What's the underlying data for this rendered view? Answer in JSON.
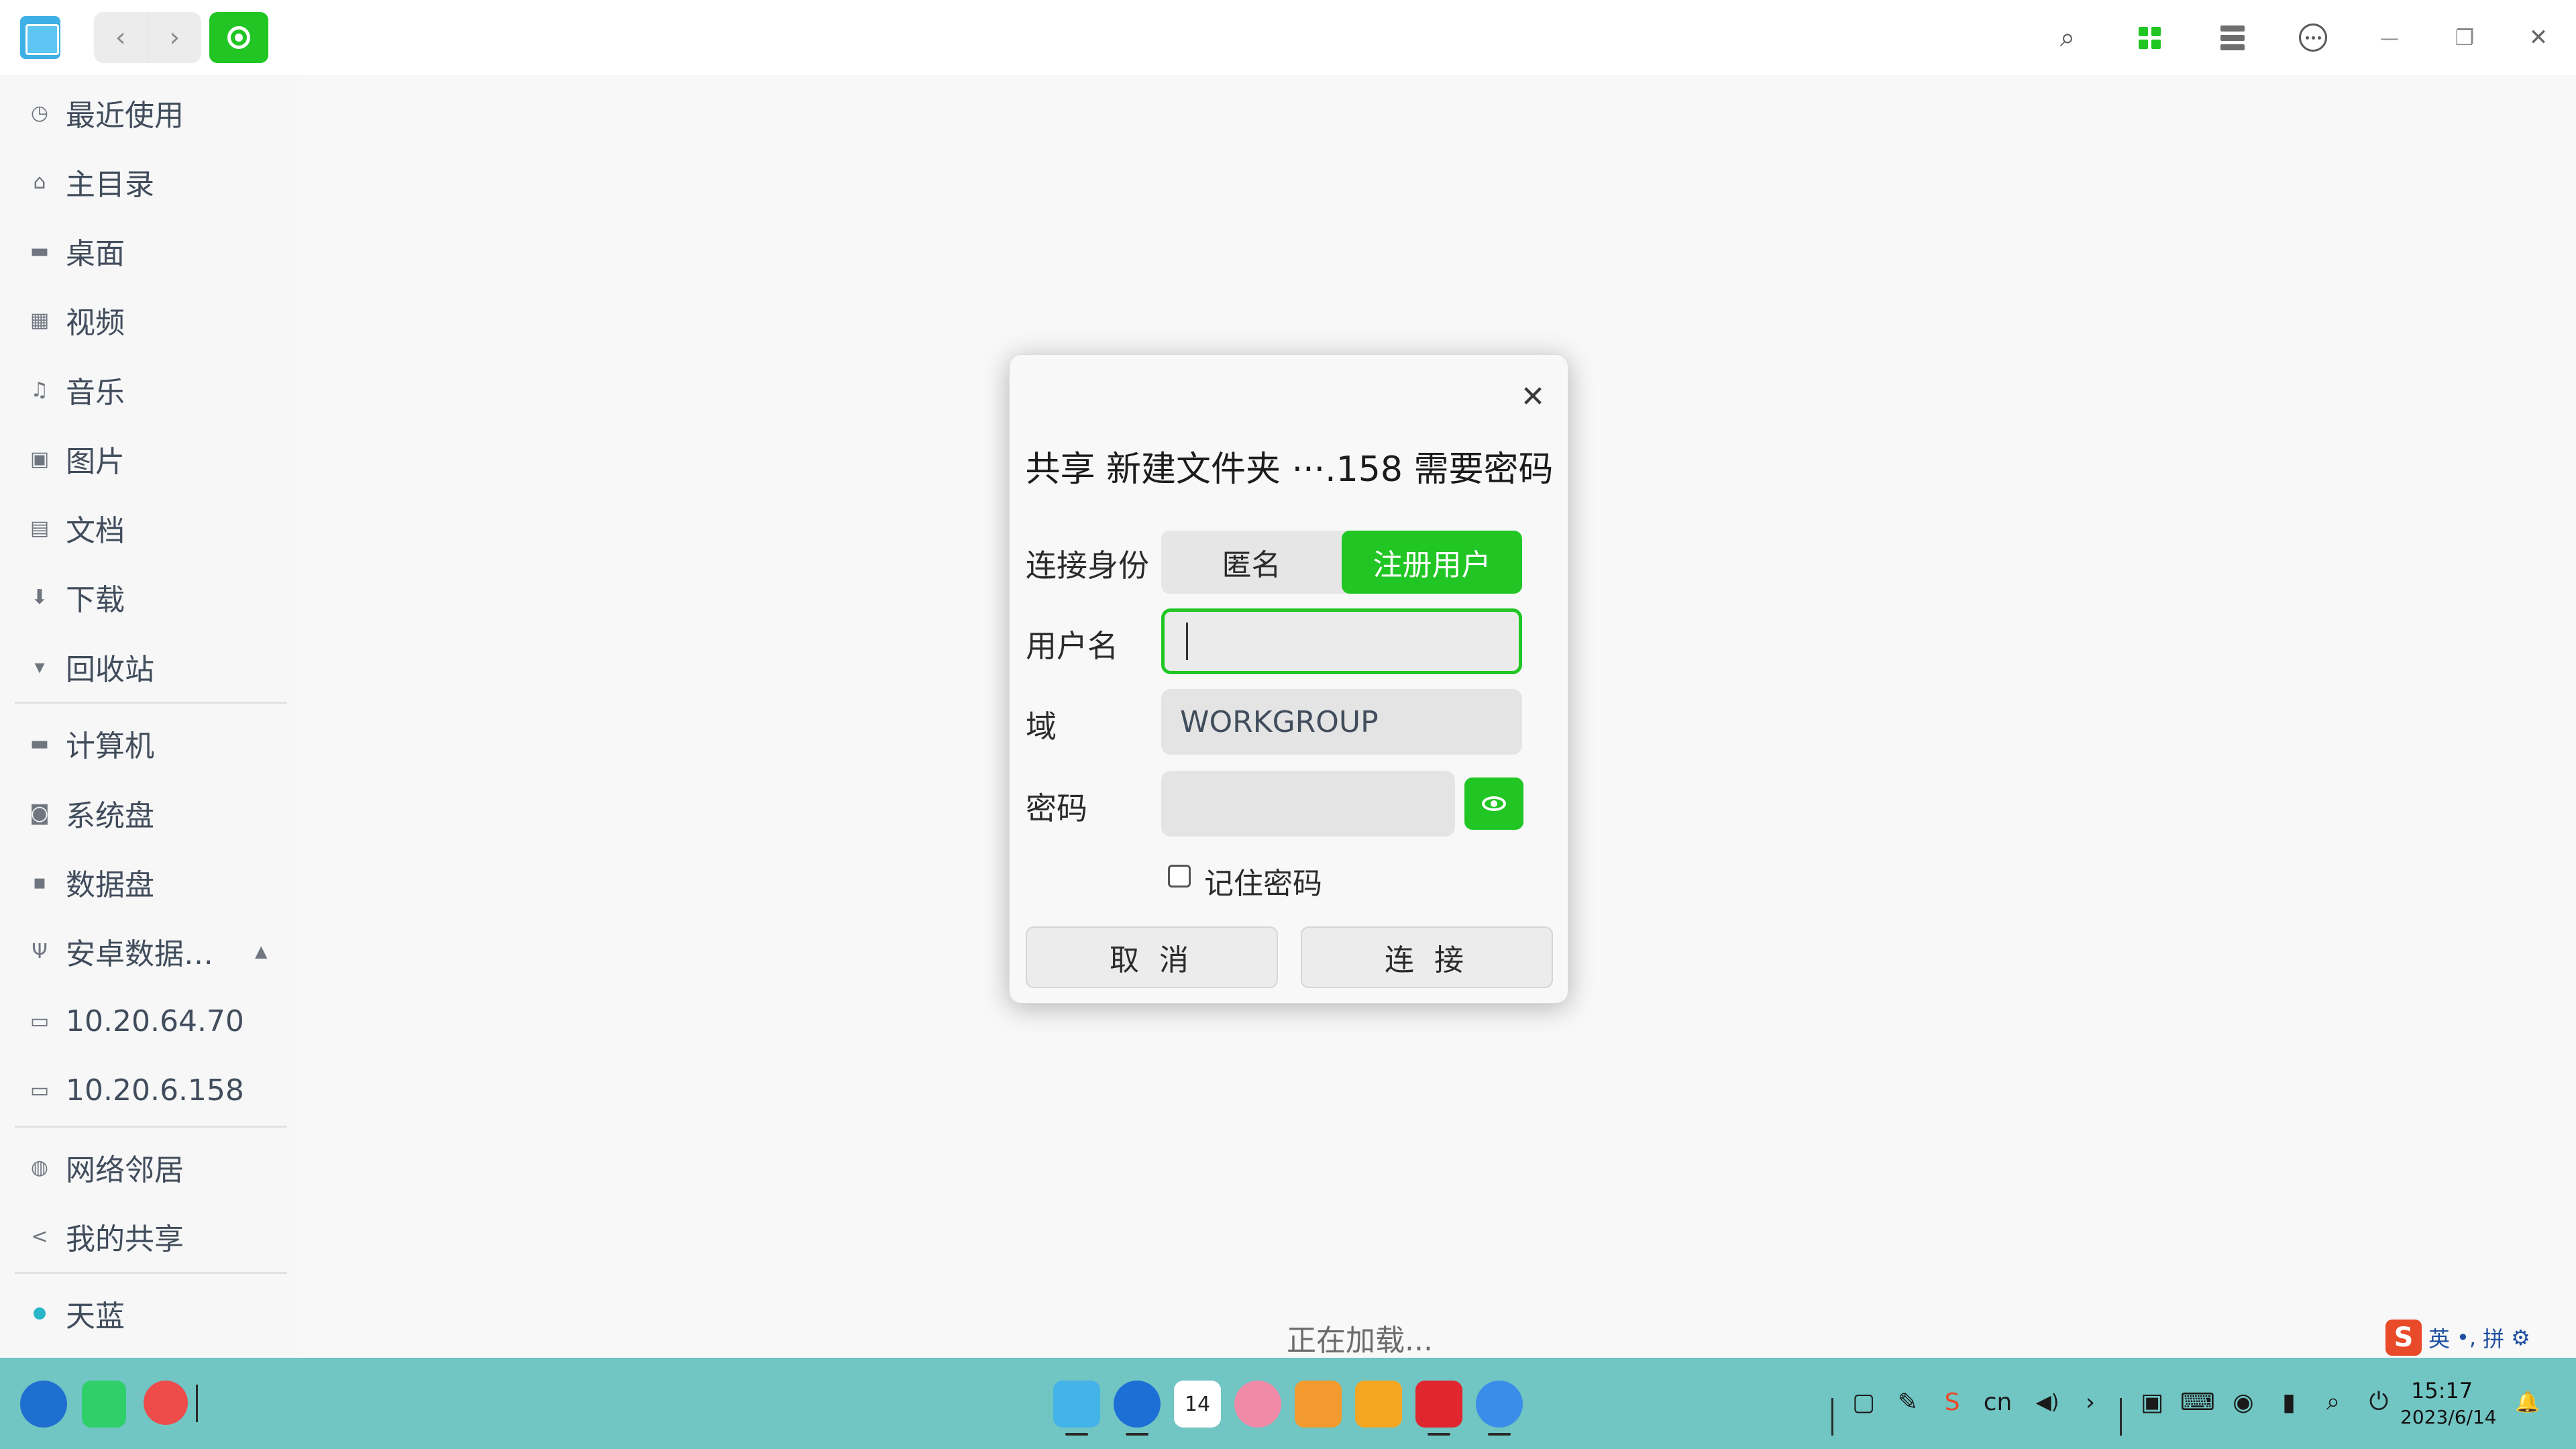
{
  "titlebar": {
    "back_icon": "‹",
    "forward_icon": "›",
    "icons": [
      "search-icon",
      "grid-view-icon",
      "list-view-icon",
      "more-icon",
      "minimize-icon",
      "maximize-icon",
      "close-icon"
    ],
    "search_glyph": "⌕",
    "minimize_glyph": "—",
    "maximize_glyph": "❐",
    "close_glyph": "✕"
  },
  "sidebar": {
    "items": [
      {
        "label": "最近使用",
        "icon": "clock-icon",
        "glyph": "◷"
      },
      {
        "label": "主目录",
        "icon": "home-icon",
        "glyph": "⌂"
      },
      {
        "label": "桌面",
        "icon": "desktop-icon",
        "glyph": "▬"
      },
      {
        "label": "视频",
        "icon": "video-icon",
        "glyph": "▦"
      },
      {
        "label": "音乐",
        "icon": "music-icon",
        "glyph": "♫"
      },
      {
        "label": "图片",
        "icon": "picture-icon",
        "glyph": "▣"
      },
      {
        "label": "文档",
        "icon": "document-icon",
        "glyph": "▤"
      },
      {
        "label": "下载",
        "icon": "download-icon",
        "glyph": "⬇"
      },
      {
        "label": "回收站",
        "icon": "trash-icon",
        "glyph": "▾"
      },
      {
        "label": "计算机",
        "icon": "computer-icon",
        "glyph": "▬"
      },
      {
        "label": "系统盘",
        "icon": "system-disk-icon",
        "glyph": "◙"
      },
      {
        "label": "数据盘",
        "icon": "data-disk-icon",
        "glyph": "▪"
      },
      {
        "label": "安卓数据…",
        "icon": "usb-icon",
        "glyph": "Ψ",
        "eject": "▲"
      },
      {
        "label": "10.20.64.70",
        "icon": "network-share-icon",
        "glyph": "▭"
      },
      {
        "label": "10.20.6.158",
        "icon": "network-share-icon",
        "glyph": "▭"
      },
      {
        "label": "网络邻居",
        "icon": "network-icon",
        "glyph": "◍"
      },
      {
        "label": "我的共享",
        "icon": "share-icon",
        "glyph": "<"
      },
      {
        "label": "天蓝",
        "icon": "tag-dot-icon",
        "glyph": ""
      }
    ]
  },
  "main": {
    "status": "正在加载..."
  },
  "dialog": {
    "close_glyph": "✕",
    "title": "共享 新建文件夹 ···.158 需要密码",
    "identity_label": "连接身份",
    "identity_options": [
      "匿名",
      "注册用户"
    ],
    "identity_selected": "注册用户",
    "username_label": "用户名",
    "username_value": "",
    "domain_label": "域",
    "domain_value": "WORKGROUP",
    "password_label": "密码",
    "password_value": "",
    "remember_label": "记住密码",
    "remember_checked": false,
    "cancel_label": "取 消",
    "connect_label": "连 接"
  },
  "taskbar": {
    "ime": {
      "logo": "S",
      "lang": "英",
      "punct": "•,",
      "mode": "拼",
      "settings": "⚙"
    },
    "tray": {
      "lang": "cn",
      "volume_glyph": "◀)",
      "arrow_glyph": "›",
      "search_glyph": "⌕",
      "power_glyph": "⏻",
      "bell_glyph": "🔔"
    },
    "clock_time": "15:17",
    "clock_date": "2023/6/14",
    "calendar_day": "14"
  },
  "colors": {
    "accent": "#21c624",
    "taskbar": "#71c5c3"
  }
}
